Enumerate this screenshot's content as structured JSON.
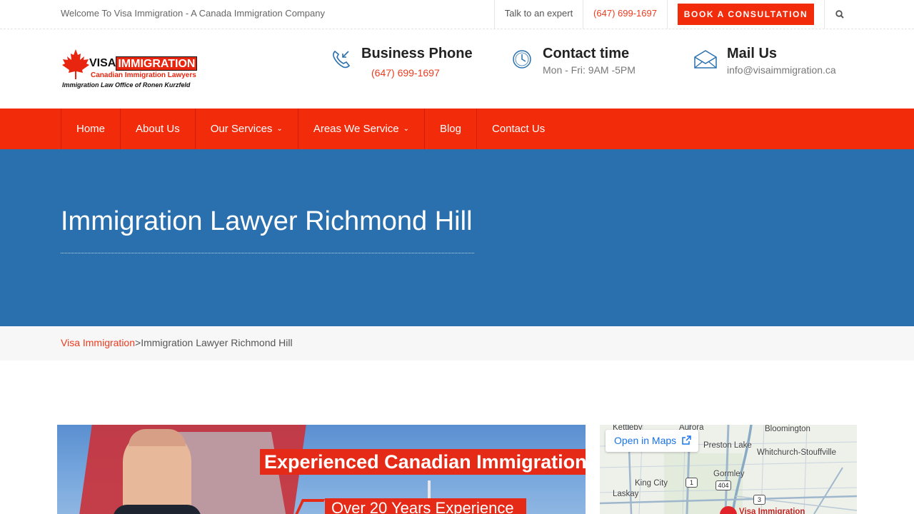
{
  "topbar": {
    "welcome": "Welcome To Visa Immigration - A Canada Immigration Company",
    "expert_label": "Talk to an expert",
    "phone": "(647) 699-1697",
    "book_label": "BOOK A CONSULTATION",
    "search_icon": "search-icon"
  },
  "logo": {
    "visa": "VISA",
    "immigration": "IMMIGRATION",
    "subtitle": "Canadian Immigration Lawyers",
    "office": "Immigration Law Office of Ronen Kurzfeld"
  },
  "header_info": [
    {
      "icon": "phone-icon",
      "title": "Business Phone",
      "value": "(647) 699-1697"
    },
    {
      "icon": "clock-icon",
      "title": "Contact time",
      "value": "Mon - Fri: 9AM -5PM"
    },
    {
      "icon": "mail-icon",
      "title": "Mail Us",
      "value": "info@visaimmigration.ca"
    }
  ],
  "nav": [
    {
      "label": "Home",
      "has_dropdown": false
    },
    {
      "label": "About Us",
      "has_dropdown": false
    },
    {
      "label": "Our Services",
      "has_dropdown": true
    },
    {
      "label": "Areas We Service",
      "has_dropdown": true
    },
    {
      "label": "Blog",
      "has_dropdown": false
    },
    {
      "label": "Contact Us",
      "has_dropdown": false
    }
  ],
  "hero": {
    "title": "Immigration Lawyer Richmond Hill"
  },
  "breadcrumb": {
    "home": "Visa Immigration",
    "separator": ">",
    "current": "Immigration Lawyer Richmond Hill"
  },
  "banner": {
    "headline": "Experienced Canadian Immigration Lawyer",
    "subline": "Over 20 Years Experience"
  },
  "map": {
    "open_label": "Open in Maps",
    "places": [
      "Kettleby",
      "Aurora",
      "Bloomington",
      "Preston Lake",
      "Whitchurch-Stouffville",
      "Gormley",
      "King City",
      "Laskay",
      "Visa Immigration"
    ],
    "routes": [
      "1",
      "404",
      "3"
    ]
  },
  "colors": {
    "accent_red": "#f22b0b",
    "hero_blue": "#2b70ae",
    "link_red": "#ee3b1f"
  }
}
